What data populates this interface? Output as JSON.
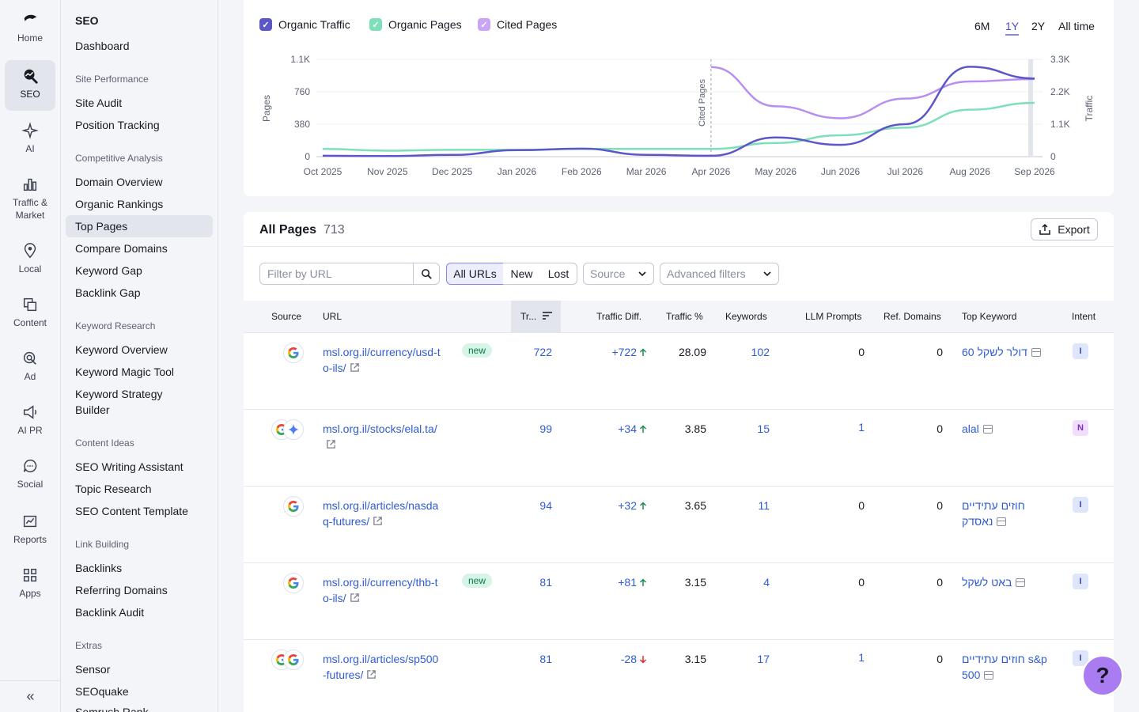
{
  "rail": {
    "items": [
      {
        "label": "Home",
        "icon": "home-icon"
      },
      {
        "label": "SEO",
        "icon": "seo-icon"
      },
      {
        "label": "AI",
        "icon": "ai-icon"
      },
      {
        "label": "Traffic & Market",
        "icon": "traffic-icon"
      },
      {
        "label": "Local",
        "icon": "local-pin-icon"
      },
      {
        "label": "Content",
        "icon": "content-icon"
      },
      {
        "label": "Ad",
        "icon": "ad-icon"
      },
      {
        "label": "AI PR",
        "icon": "megaphone-icon"
      },
      {
        "label": "Social",
        "icon": "social-icon"
      },
      {
        "label": "Reports",
        "icon": "reports-icon"
      },
      {
        "label": "Apps",
        "icon": "apps-icon"
      }
    ],
    "collapse": "«"
  },
  "subnav": {
    "title": "SEO",
    "dashboard": "Dashboard",
    "groups": {
      "site_performance": "Site Performance",
      "competitive": "Competitive Analysis",
      "keyword_research": "Keyword Research",
      "content_ideas": "Content Ideas",
      "link_building": "Link Building",
      "extras": "Extras"
    },
    "items": {
      "site_audit": "Site Audit",
      "position_tracking": "Position Tracking",
      "domain_overview": "Domain Overview",
      "organic_rankings": "Organic Rankings",
      "top_pages": "Top Pages",
      "compare_domains": "Compare Domains",
      "keyword_gap": "Keyword Gap",
      "backlink_gap": "Backlink Gap",
      "keyword_overview": "Keyword Overview",
      "keyword_magic": "Keyword Magic Tool",
      "keyword_strategy": "Keyword Strategy Builder",
      "seo_writing": "SEO Writing Assistant",
      "topic_research": "Topic Research",
      "seo_content_template": "SEO Content Template",
      "backlinks": "Backlinks",
      "referring_domains": "Referring Domains",
      "backlink_audit": "Backlink Audit",
      "sensor": "Sensor",
      "seoquake": "SEOquake",
      "semrush_rank": "Semrush Rank"
    }
  },
  "chart": {
    "legend": [
      "Organic Traffic",
      "Organic Pages",
      "Cited Pages"
    ],
    "ranges": [
      "6M",
      "1Y",
      "2Y",
      "All time"
    ],
    "active_range": "1Y",
    "annotation": "Cited Pages",
    "colors": {
      "traffic": "#5b57c9",
      "pages": "#7ee0b8",
      "cited": "#b88ff0"
    }
  },
  "chart_data": {
    "type": "line",
    "x": [
      "Oct 2025",
      "Nov 2025",
      "Dec 2025",
      "Jan 2026",
      "Feb 2026",
      "Mar 2026",
      "Apr 2026",
      "May 2026",
      "Jun 2026",
      "Jul 2026",
      "Aug 2026",
      "Sep 2026"
    ],
    "ylabel": "Pages",
    "y2label": "Traffic",
    "yticks": [
      "0",
      "380",
      "760",
      "1.1K"
    ],
    "y2ticks": [
      "0",
      "1.1K",
      "2.2K",
      "3.3K"
    ],
    "ylim": [
      0,
      1140
    ],
    "y2lim": [
      0,
      3300
    ],
    "series": [
      {
        "name": "Organic Traffic",
        "axis": "right",
        "values": [
          30,
          20,
          60,
          220,
          270,
          60,
          30,
          650,
          400,
          1100,
          3050,
          2650
        ]
      },
      {
        "name": "Organic Pages",
        "axis": "left",
        "values": [
          90,
          70,
          80,
          80,
          90,
          90,
          90,
          160,
          250,
          340,
          550,
          630
        ]
      },
      {
        "name": "Cited Pages",
        "axis": "left",
        "values": [
          null,
          null,
          null,
          null,
          null,
          null,
          1050,
          590,
          450,
          680,
          880,
          910
        ]
      }
    ]
  },
  "table": {
    "title": "All Pages",
    "count": "713",
    "export": "Export",
    "filter_placeholder": "Filter by URL",
    "segments": [
      "All URLs",
      "New",
      "Lost"
    ],
    "source_dropdown": "Source",
    "advanced_dropdown": "Advanced filters",
    "columns": [
      "Source",
      "URL",
      "Tr...",
      "Traffic Diff.",
      "Traffic %",
      "Keywords",
      "LLM Prompts",
      "Ref. Domains",
      "Top Keyword",
      "Intent"
    ],
    "rows": [
      {
        "url": "msl.org.il/currency/usd-to-ils/",
        "badge": "new",
        "traffic": "722",
        "diff": "+722",
        "dir": "up",
        "pct": "28.09",
        "keywords": "102",
        "llm": "0",
        "llm_link": false,
        "ref": "0",
        "keyword": "60 דולר לשקל",
        "intent": "I",
        "sources": [
          "google"
        ]
      },
      {
        "url": "msl.org.il/stocks/elal.ta/",
        "badge": "",
        "traffic": "99",
        "diff": "+34",
        "dir": "up",
        "pct": "3.85",
        "keywords": "15",
        "llm": "1",
        "llm_link": true,
        "ref": "0",
        "keyword": "alal",
        "intent": "N",
        "sources": [
          "google",
          "gemini"
        ]
      },
      {
        "url": "msl.org.il/articles/nasdaq-futures/",
        "badge": "",
        "traffic": "94",
        "diff": "+32",
        "dir": "up",
        "pct": "3.65",
        "keywords": "11",
        "llm": "0",
        "llm_link": false,
        "ref": "0",
        "keyword": "חוזים עתידיים נאסדק",
        "intent": "I",
        "sources": [
          "google"
        ]
      },
      {
        "url": "msl.org.il/currency/thb-to-ils/",
        "badge": "new",
        "traffic": "81",
        "diff": "+81",
        "dir": "up",
        "pct": "3.15",
        "keywords": "4",
        "llm": "0",
        "llm_link": false,
        "ref": "0",
        "keyword": "באט לשקל",
        "intent": "I",
        "sources": [
          "google"
        ]
      },
      {
        "url": "msl.org.il/articles/sp500-futures/",
        "badge": "",
        "traffic": "81",
        "diff": "-28",
        "dir": "down",
        "pct": "3.15",
        "keywords": "17",
        "llm": "1",
        "llm_link": true,
        "ref": "0",
        "keyword": "חוזים עתידיים s&p 500",
        "intent": "I",
        "sources": [
          "google",
          "google"
        ]
      }
    ]
  },
  "help": "?"
}
